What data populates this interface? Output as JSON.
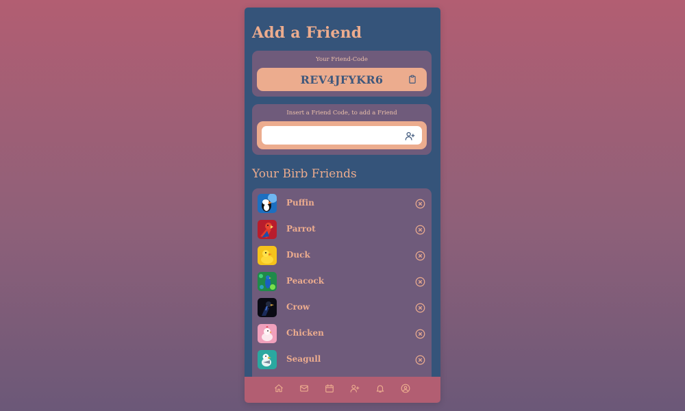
{
  "page": {
    "title": "Add a Friend"
  },
  "friend_code": {
    "label": "Your Friend-Code",
    "code": "REV4JFYKR6",
    "copy_icon": "clipboard-icon"
  },
  "add_friend": {
    "label": "Insert a Friend Code, to add a Friend",
    "input_value": "",
    "placeholder": "",
    "button_icon": "user-plus-icon"
  },
  "friends_section": {
    "title": "Your Birb Friends",
    "friends": [
      {
        "name": "Puffin",
        "avatar": "puffin-avatar"
      },
      {
        "name": "Parrot",
        "avatar": "parrot-avatar"
      },
      {
        "name": "Duck",
        "avatar": "duck-avatar"
      },
      {
        "name": "Peacock",
        "avatar": "peacock-avatar"
      },
      {
        "name": "Crow",
        "avatar": "crow-avatar"
      },
      {
        "name": "Chicken",
        "avatar": "chicken-avatar"
      },
      {
        "name": "Seagull",
        "avatar": "seagull-avatar"
      }
    ],
    "remove_icon": "circle-x-icon"
  },
  "bottom_nav": {
    "items": [
      "home-icon",
      "mail-icon",
      "calendar-icon",
      "user-plus-icon",
      "bell-icon",
      "user-circle-icon"
    ]
  },
  "colors": {
    "background_top": "#b25e72",
    "background_bottom": "#6b5878",
    "panel": "#35547a",
    "card": "#6f5b7b",
    "accent": "#ecac8e",
    "nav": "#b25e72",
    "code_text": "#3f587c"
  }
}
